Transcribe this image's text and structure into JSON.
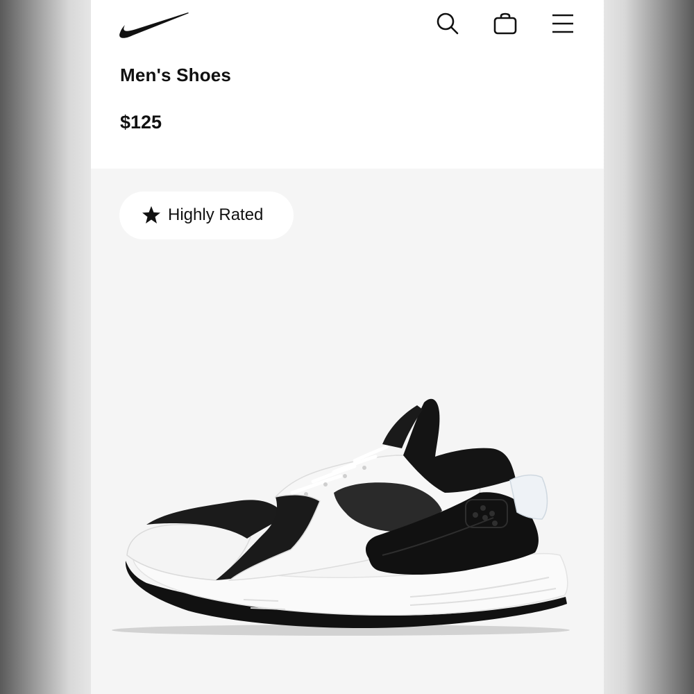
{
  "header": {
    "logo_icon": "swoosh-logo-icon",
    "search_icon": "search-icon",
    "bag_icon": "shopping-bag-icon",
    "menu_icon": "hamburger-menu-icon"
  },
  "product": {
    "category": "Men's Shoes",
    "price": "$125",
    "badge": {
      "icon": "star-icon",
      "label": "Highly Rated"
    },
    "image_icon": "sneaker-product-image"
  },
  "colors": {
    "page_bg": "#f5f5f5",
    "header_bg": "#ffffff",
    "text": "#111111"
  }
}
